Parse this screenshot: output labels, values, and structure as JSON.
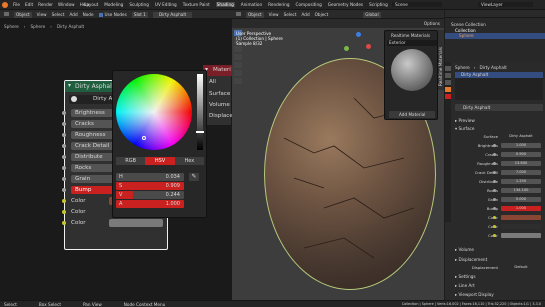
{
  "topbar": {
    "menus": [
      "File",
      "Edit",
      "Render",
      "Window",
      "Help"
    ],
    "workspaces": [
      "Layout",
      "Modeling",
      "Sculpting",
      "UV Editing",
      "Texture Paint",
      "Shading",
      "Animation",
      "Rendering",
      "Compositing",
      "Geometry Nodes",
      "Scripting"
    ],
    "active_workspace": "Shading",
    "scene": "Scene",
    "view_layer": "ViewLayer"
  },
  "node_editor": {
    "header": {
      "mode": "Object",
      "menus": [
        "View",
        "Select",
        "Add",
        "Node"
      ],
      "use_nodes": "Use Nodes",
      "slot": "Slot 1",
      "material": "Dirty Asphalt"
    },
    "breadcrumb": [
      "Sphere",
      "Sphere",
      "Dirty Asphalt"
    ],
    "group_node": {
      "title": "Dirty Asphalt",
      "datablock": "Dirty As",
      "inputs": [
        "Brightness",
        "Cracks",
        "Roughness",
        "Crack Detail",
        "Distribute",
        "Rocks",
        "Grain",
        "Bump",
        "Color",
        "Color",
        "Color"
      ],
      "active_input": "Bump"
    },
    "material_output": {
      "title": "Materi",
      "items": [
        "All",
        "Surface",
        "Volume",
        "Displacer"
      ]
    },
    "color_picker": {
      "modes": [
        "RGB",
        "HSV",
        "Hex"
      ],
      "active_mode": "HSV",
      "fields": [
        {
          "label": "H",
          "value": "0.034"
        },
        {
          "label": "S",
          "value": "0.909"
        },
        {
          "label": "V",
          "value": "0.244"
        },
        {
          "label": "A",
          "value": "1.000"
        }
      ]
    }
  },
  "viewport": {
    "header": {
      "mode": "Object",
      "menus": [
        "View",
        "Select",
        "Add",
        "Object"
      ],
      "transform": "Global",
      "options": "Options"
    },
    "overlay_text": [
      "User Perspective",
      "(1) Collection | Sphere",
      "Sample 8/32"
    ],
    "material_popup": {
      "title": "Realtime Materials",
      "search": "Exterior",
      "button": "Add Material"
    },
    "side_tab": "Realtime Materials"
  },
  "outliner": {
    "items": [
      "Scene Collection",
      "Collection",
      "Sphere"
    ]
  },
  "properties": {
    "object": "Sphere",
    "material_slot": "Dirty Asphalt",
    "material": "Dirty Asphalt",
    "sections": [
      "Preview",
      "Surface"
    ],
    "surface": {
      "label": "Surface",
      "value": "Dirty Asphalt"
    },
    "rows": [
      {
        "label": "Brightness",
        "value": "1.000"
      },
      {
        "label": "Cracks",
        "value": "0.900"
      },
      {
        "label": "Roughness",
        "value": "13.600"
      },
      {
        "label": "Crack Detail",
        "value": "7.000"
      },
      {
        "label": "Distribute",
        "value": "1.250"
      },
      {
        "label": "Rocks",
        "value": "134.100"
      },
      {
        "label": "Grain",
        "value": "5.000"
      },
      {
        "label": "Bump",
        "value": "1.000"
      },
      {
        "label": "Color",
        "value": ""
      },
      {
        "label": "Color",
        "value": ""
      },
      {
        "label": "Color",
        "value": ""
      }
    ],
    "lower_sections": [
      "Volume",
      "Displacement",
      "Settings",
      "Line Art",
      "Viewport Display"
    ],
    "displacement": {
      "label": "Displacement",
      "value": "Default"
    }
  },
  "statusbar": {
    "items": [
      "Select",
      "Box Select",
      "Pan View",
      "Node Context Menu"
    ],
    "info": "Collection | Sphere | Verts:16,002 | Faces:16,110 | Tris:32,220 | Objects:1/1 | 3.3.0"
  },
  "colors": {
    "accent": "#e8782a",
    "active_red": "#c92020",
    "bump_color": "#8a4634"
  }
}
